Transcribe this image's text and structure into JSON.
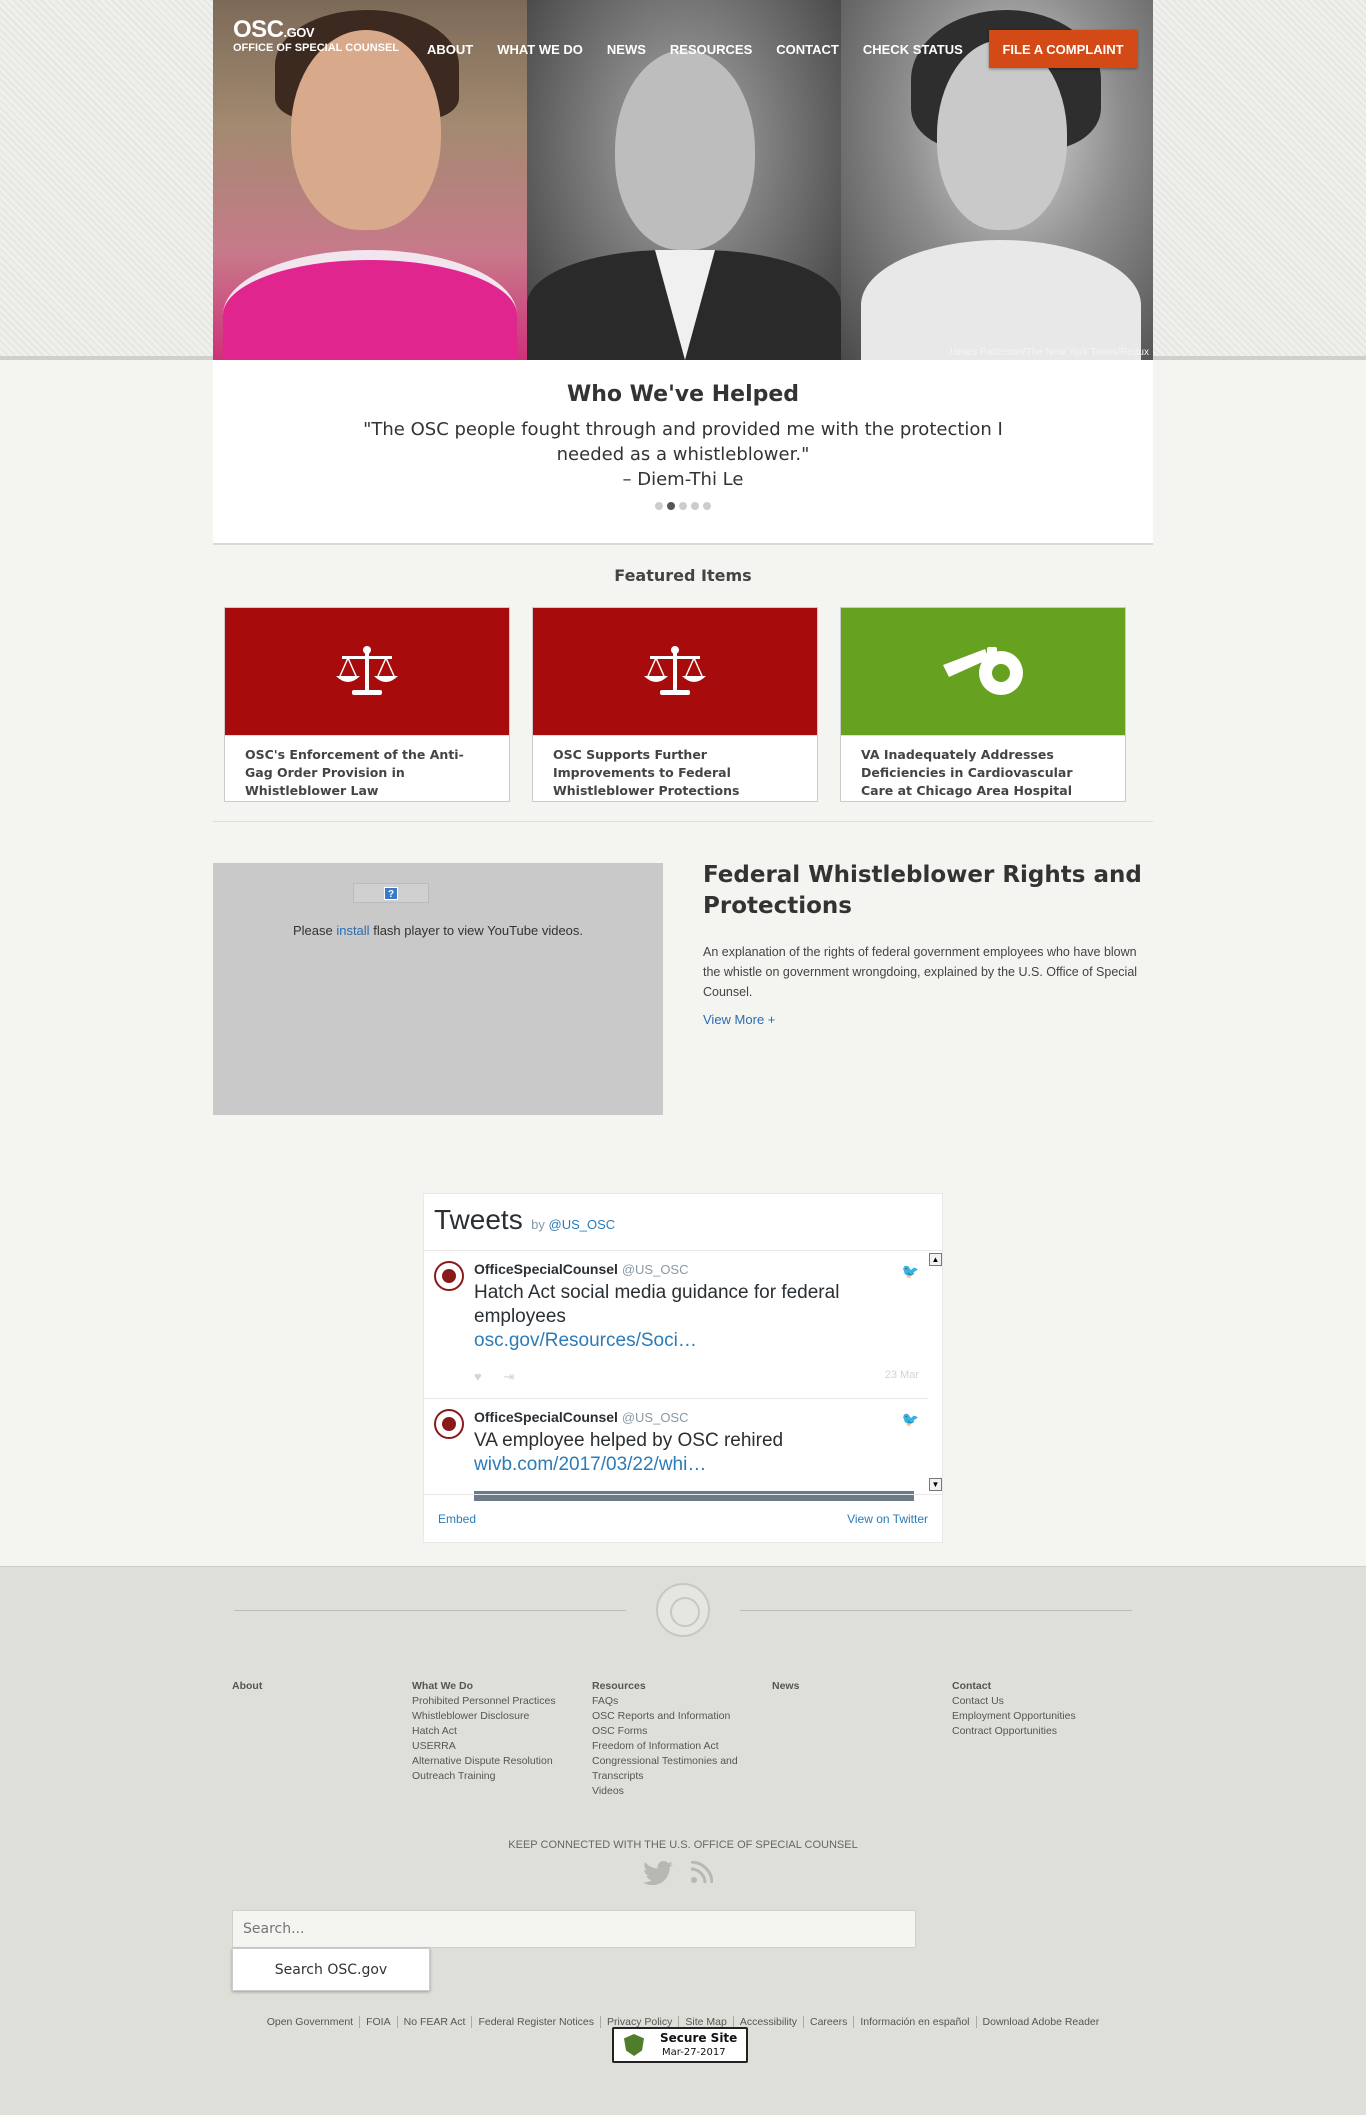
{
  "header": {
    "logo_main": "OSC",
    "logo_tld": ".GOV",
    "logo_sub": "OFFICE OF SPECIAL COUNSEL",
    "nav": [
      "ABOUT",
      "WHAT WE DO",
      "NEWS",
      "RESOURCES",
      "CONTACT",
      "CHECK STATUS"
    ],
    "cta": "FILE A COMPLAINT",
    "photo_credit": "James Patterson/The New York Times/Redux"
  },
  "testimonial": {
    "title": "Who We've Helped",
    "quote": "\"The OSC people fought through and provided me with the protection I needed as a whistleblower.\"",
    "author": "– Diem-Thi Le",
    "active_slide": 2,
    "slide_count": 5
  },
  "featured": {
    "title": "Featured Items",
    "items": [
      {
        "caption": "OSC's Enforcement of the Anti-Gag Order Provision in Whistleblower Law",
        "icon": "scales-icon",
        "color": "#a80b0b"
      },
      {
        "caption": "OSC Supports Further Improvements to Federal Whistleblower Protections",
        "icon": "scales-icon",
        "color": "#a80b0b"
      },
      {
        "caption": "VA Inadequately Addresses Deficiencies in Cardiovascular Care at Chicago Area Hospital",
        "icon": "whistle-icon",
        "color": "#66a21f"
      }
    ]
  },
  "video": {
    "msg_before": "Please",
    "msg_link": "install",
    "msg_after": "flash player to view YouTube videos.",
    "title": "Federal Whistleblower Rights and Protections",
    "description": "An explanation of the rights of federal government employees who have blown the whistle on government wrongdoing, explained by the U.S. Office of Special Counsel.",
    "more": "View More +"
  },
  "tweets": {
    "title": "Tweets",
    "by": "by",
    "handle": "@US_OSC",
    "items": [
      {
        "name": "OfficeSpecialCounsel",
        "handle": "@US_OSC",
        "text": "Hatch Act social media guidance for federal employees",
        "link": "osc.gov/Resources/Soci…",
        "date": "23 Mar"
      },
      {
        "name": "OfficeSpecialCounsel",
        "handle": "@US_OSC",
        "text": "VA employee helped by OSC rehired",
        "link": "wivb.com/2017/03/22/whi…"
      }
    ],
    "embed": "Embed",
    "view_on": "View on Twitter"
  },
  "footer": {
    "columns": [
      {
        "heading": "About",
        "links": []
      },
      {
        "heading": "What We Do",
        "links": [
          "Prohibited Personnel Practices",
          "Whistleblower Disclosure",
          "Hatch Act",
          "USERRA",
          "Alternative Dispute Resolution",
          "Outreach Training"
        ]
      },
      {
        "heading": "Resources",
        "links": [
          "FAQs",
          "OSC Reports and Information",
          "OSC Forms",
          "Freedom of Information Act",
          "Congressional Testimonies and Transcripts",
          "Videos"
        ]
      },
      {
        "heading": "News",
        "links": []
      },
      {
        "heading": "Contact",
        "links": [
          "Contact Us",
          "Employment Opportunities",
          "Contract Opportunities"
        ]
      }
    ],
    "keep_connected": "KEEP CONNECTED WITH THE U.S. OFFICE OF SPECIAL COUNSEL",
    "search_placeholder": "Search...",
    "search_button": "Search OSC.gov",
    "links": [
      "Open Government",
      "FOIA",
      "No FEAR Act",
      "Federal Register Notices",
      "Privacy Policy",
      "Site Map",
      "Accessibility",
      "Careers",
      "Información en español",
      "Download Adobe Reader"
    ],
    "secure_title": "Secure Site",
    "secure_date": "Mar-27-2017"
  }
}
